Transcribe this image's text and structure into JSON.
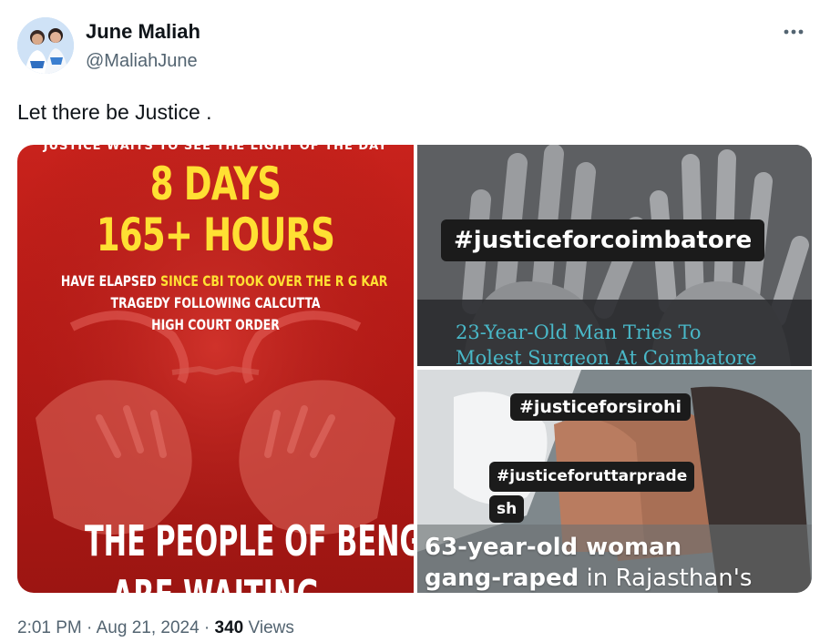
{
  "author": {
    "name": "June Maliah",
    "handle": "@MaliahJune"
  },
  "tweet": {
    "text": "Let there be Justice ."
  },
  "media": {
    "left_poster": {
      "top_strip": "JUSTICE WAITS TO SEE THE LIGHT OF THE DAY",
      "line1": "8 DAYS",
      "line2": "165+ HOURS",
      "detail_1a": "HAVE ELAPSED ",
      "detail_1b": "SINCE CBI TOOK OVER THE R G KAR",
      "detail_2": "TRAGEDY FOLLOWING CALCUTTA",
      "detail_3": "HIGH COURT ORDER",
      "bottom_1": "THE PEOPLE OF BENGAL",
      "bottom_2": "ARE WAITING"
    },
    "top_right": {
      "hashtag": "#justiceforcoimbatore",
      "headline_1": "23-Year-Old Man Tries To",
      "headline_2": "Molest Surgeon At Coimbatore"
    },
    "bottom_right": {
      "hashtag_1": "#justiceforsirohi",
      "hashtag_2a": "#justiceforuttarprade",
      "hashtag_2b": "sh",
      "headline_1": "63-year-old woman",
      "headline_2a": "gang-raped",
      "headline_2b": " in Rajasthan's"
    }
  },
  "meta": {
    "time": "2:01 PM",
    "separator": " · ",
    "date": "Aug 21, 2024",
    "views_count": "340",
    "views_label": " Views"
  },
  "icons": {
    "more": "more-options-icon"
  },
  "colors": {
    "poster_red": "#c8221c",
    "poster_yellow": "#ffe033",
    "headline_teal": "#49b8c8",
    "muted_text": "#536471"
  }
}
